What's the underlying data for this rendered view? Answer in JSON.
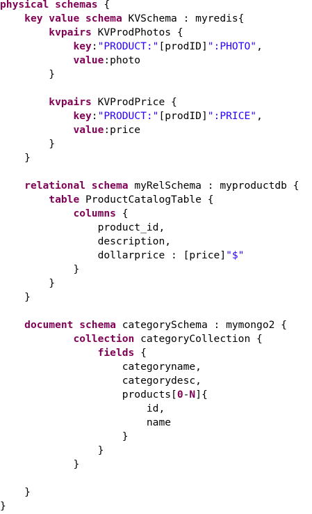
{
  "lines": [
    {
      "indent": "",
      "parts": [
        {
          "t": "kw",
          "v": "physical schemas"
        },
        {
          "t": "plain",
          "v": " {"
        }
      ]
    },
    {
      "indent": "    ",
      "parts": [
        {
          "t": "kw",
          "v": "key value schema"
        },
        {
          "t": "plain",
          "v": " KVSchema : myredis{"
        }
      ]
    },
    {
      "indent": "        ",
      "parts": [
        {
          "t": "kw",
          "v": "kvpairs"
        },
        {
          "t": "plain",
          "v": " KVProdPhotos {"
        }
      ]
    },
    {
      "indent": "            ",
      "parts": [
        {
          "t": "kw",
          "v": "key"
        },
        {
          "t": "plain",
          "v": ":"
        },
        {
          "t": "str",
          "v": "\"PRODUCT:\""
        },
        {
          "t": "plain",
          "v": "[prodID]"
        },
        {
          "t": "str",
          "v": "\":PHOTO\""
        },
        {
          "t": "plain",
          "v": ","
        }
      ]
    },
    {
      "indent": "            ",
      "parts": [
        {
          "t": "kw",
          "v": "value"
        },
        {
          "t": "plain",
          "v": ":photo"
        }
      ]
    },
    {
      "indent": "        ",
      "parts": [
        {
          "t": "plain",
          "v": "}"
        }
      ]
    },
    {
      "indent": "",
      "parts": []
    },
    {
      "indent": "        ",
      "parts": [
        {
          "t": "kw",
          "v": "kvpairs"
        },
        {
          "t": "plain",
          "v": " KVProdPrice {"
        }
      ]
    },
    {
      "indent": "            ",
      "parts": [
        {
          "t": "kw",
          "v": "key"
        },
        {
          "t": "plain",
          "v": ":"
        },
        {
          "t": "str",
          "v": "\"PRODUCT:\""
        },
        {
          "t": "plain",
          "v": "[prodID]"
        },
        {
          "t": "str",
          "v": "\":PRICE\""
        },
        {
          "t": "plain",
          "v": ","
        }
      ]
    },
    {
      "indent": "            ",
      "parts": [
        {
          "t": "kw",
          "v": "value"
        },
        {
          "t": "plain",
          "v": ":price"
        }
      ]
    },
    {
      "indent": "        ",
      "parts": [
        {
          "t": "plain",
          "v": "}"
        }
      ]
    },
    {
      "indent": "    ",
      "parts": [
        {
          "t": "plain",
          "v": "}"
        }
      ]
    },
    {
      "indent": "",
      "parts": []
    },
    {
      "indent": "    ",
      "parts": [
        {
          "t": "kw",
          "v": "relational schema"
        },
        {
          "t": "plain",
          "v": " myRelSchema : myproductdb {"
        }
      ]
    },
    {
      "indent": "        ",
      "parts": [
        {
          "t": "kw",
          "v": "table"
        },
        {
          "t": "plain",
          "v": " ProductCatalogTable {"
        }
      ]
    },
    {
      "indent": "            ",
      "parts": [
        {
          "t": "kw",
          "v": "columns"
        },
        {
          "t": "plain",
          "v": " {"
        }
      ]
    },
    {
      "indent": "                ",
      "parts": [
        {
          "t": "plain",
          "v": "product_id,"
        }
      ]
    },
    {
      "indent": "                ",
      "parts": [
        {
          "t": "plain",
          "v": "description,"
        }
      ]
    },
    {
      "indent": "                ",
      "parts": [
        {
          "t": "plain",
          "v": "dollarprice : [price]"
        },
        {
          "t": "str",
          "v": "\"$\""
        }
      ]
    },
    {
      "indent": "            ",
      "parts": [
        {
          "t": "plain",
          "v": "}"
        }
      ]
    },
    {
      "indent": "        ",
      "parts": [
        {
          "t": "plain",
          "v": "}"
        }
      ]
    },
    {
      "indent": "    ",
      "parts": [
        {
          "t": "plain",
          "v": "}"
        }
      ]
    },
    {
      "indent": "",
      "parts": []
    },
    {
      "indent": "    ",
      "parts": [
        {
          "t": "kw",
          "v": "document schema"
        },
        {
          "t": "plain",
          "v": " categorySchema : mymongo2 {"
        }
      ]
    },
    {
      "indent": "            ",
      "parts": [
        {
          "t": "kw",
          "v": "collection"
        },
        {
          "t": "plain",
          "v": " categoryCollection {"
        }
      ]
    },
    {
      "indent": "                ",
      "parts": [
        {
          "t": "kw",
          "v": "fields"
        },
        {
          "t": "plain",
          "v": " {"
        }
      ]
    },
    {
      "indent": "                    ",
      "parts": [
        {
          "t": "plain",
          "v": "categoryname,"
        }
      ]
    },
    {
      "indent": "                    ",
      "parts": [
        {
          "t": "plain",
          "v": "categorydesc,"
        }
      ]
    },
    {
      "indent": "                    ",
      "parts": [
        {
          "t": "plain",
          "v": "products["
        },
        {
          "t": "kw",
          "v": "0"
        },
        {
          "t": "plain",
          "v": "-"
        },
        {
          "t": "kw",
          "v": "N"
        },
        {
          "t": "plain",
          "v": "]{"
        }
      ]
    },
    {
      "indent": "                        ",
      "parts": [
        {
          "t": "plain",
          "v": "id,"
        }
      ]
    },
    {
      "indent": "                        ",
      "parts": [
        {
          "t": "plain",
          "v": "name"
        }
      ]
    },
    {
      "indent": "                    ",
      "parts": [
        {
          "t": "plain",
          "v": "}"
        }
      ]
    },
    {
      "indent": "                ",
      "parts": [
        {
          "t": "plain",
          "v": "}"
        }
      ]
    },
    {
      "indent": "            ",
      "parts": [
        {
          "t": "plain",
          "v": "}"
        }
      ]
    },
    {
      "indent": "",
      "parts": []
    },
    {
      "indent": "    ",
      "parts": [
        {
          "t": "plain",
          "v": "}"
        }
      ]
    },
    {
      "indent": "",
      "parts": [
        {
          "t": "plain",
          "v": "}"
        }
      ]
    }
  ],
  "colors": {
    "keyword": "#7f0055",
    "string": "#2a00ff",
    "plain": "#000000",
    "background": "#ffffff"
  }
}
